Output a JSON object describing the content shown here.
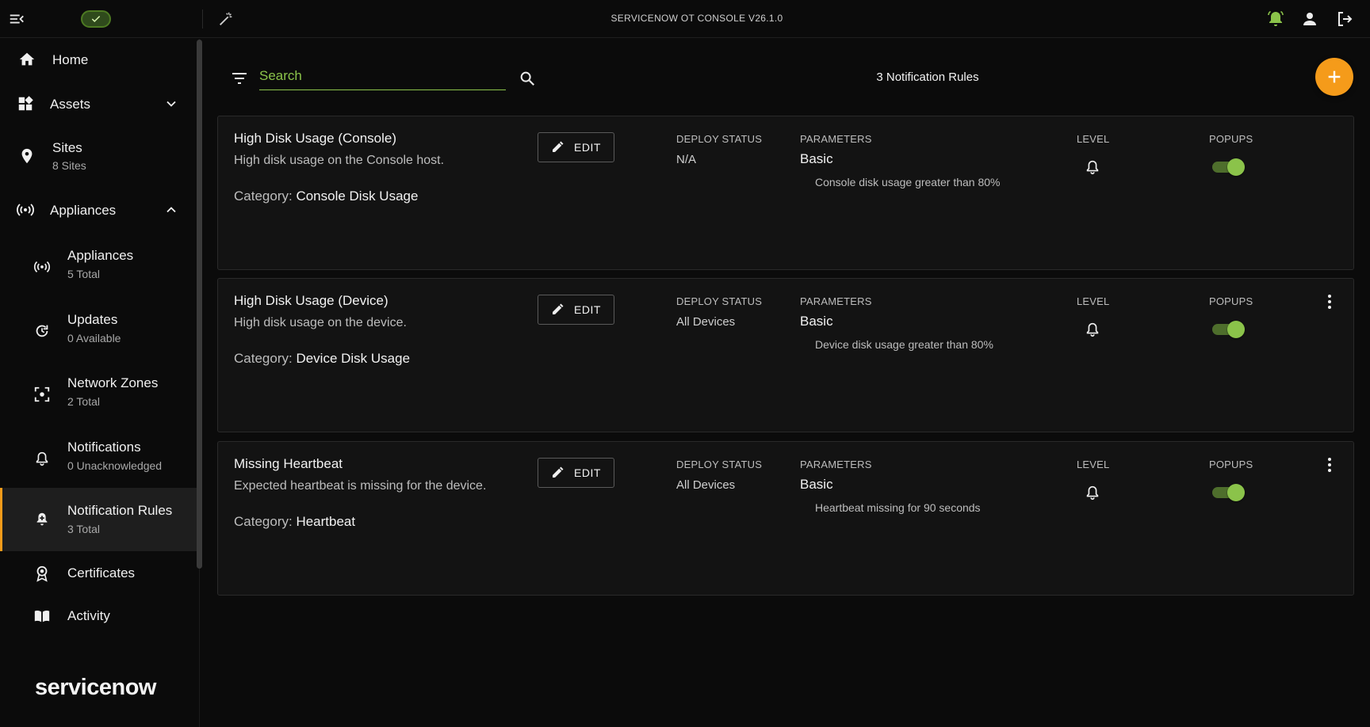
{
  "app": {
    "title": "SERVICENOW OT CONSOLE V26.1.0",
    "logo_text": "servicenow",
    "accent": "#f59b1a",
    "success": "#8bc34a"
  },
  "sidebar": {
    "items": [
      {
        "label": "Home",
        "icon": "home-icon"
      },
      {
        "label": "Assets",
        "icon": "dashboard-icon",
        "expanded": false
      },
      {
        "label": "Sites",
        "sub": "8 Sites",
        "icon": "location-pin-icon"
      },
      {
        "label": "Appliances",
        "icon": "broadcast-icon",
        "expanded": true
      },
      {
        "label": "Appliances",
        "sub": "5 Total",
        "icon": "broadcast-icon"
      },
      {
        "label": "Updates",
        "sub": "0 Available",
        "icon": "update-icon"
      },
      {
        "label": "Network Zones",
        "sub": "2 Total",
        "icon": "network-zone-icon"
      },
      {
        "label": "Notifications",
        "sub": "0 Unacknowledged",
        "icon": "bell-icon"
      },
      {
        "label": "Notification Rules",
        "sub": "3 Total",
        "icon": "bell-plus-icon",
        "active": true
      },
      {
        "label": "Certificates",
        "icon": "certificate-icon"
      },
      {
        "label": "Activity",
        "icon": "book-icon"
      }
    ]
  },
  "toolbar": {
    "search_placeholder": "Search",
    "count_label": "3 Notification Rules"
  },
  "columns": {
    "deploy": "DEPLOY STATUS",
    "params": "PARAMETERS",
    "level": "LEVEL",
    "popups": "POPUPS"
  },
  "rules": [
    {
      "title": "High Disk Usage (Console)",
      "description": "High disk usage on the Console host.",
      "category_label": "Category: ",
      "category": "Console Disk Usage",
      "edit_label": "EDIT",
      "deploy_status": "N/A",
      "param_type": "Basic",
      "param_desc": "Console disk usage greater than 80%",
      "popups_on": true,
      "has_menu": false
    },
    {
      "title": "High Disk Usage (Device)",
      "description": "High disk usage on the device.",
      "category_label": "Category: ",
      "category": "Device Disk Usage",
      "edit_label": "EDIT",
      "deploy_status": "All Devices",
      "param_type": "Basic",
      "param_desc": "Device disk usage greater than 80%",
      "popups_on": true,
      "has_menu": true
    },
    {
      "title": "Missing Heartbeat",
      "description": "Expected heartbeat is missing for the device.",
      "category_label": "Category: ",
      "category": "Heartbeat",
      "edit_label": "EDIT",
      "deploy_status": "All Devices",
      "param_type": "Basic",
      "param_desc": "Heartbeat missing for 90 seconds",
      "popups_on": true,
      "has_menu": true
    }
  ]
}
